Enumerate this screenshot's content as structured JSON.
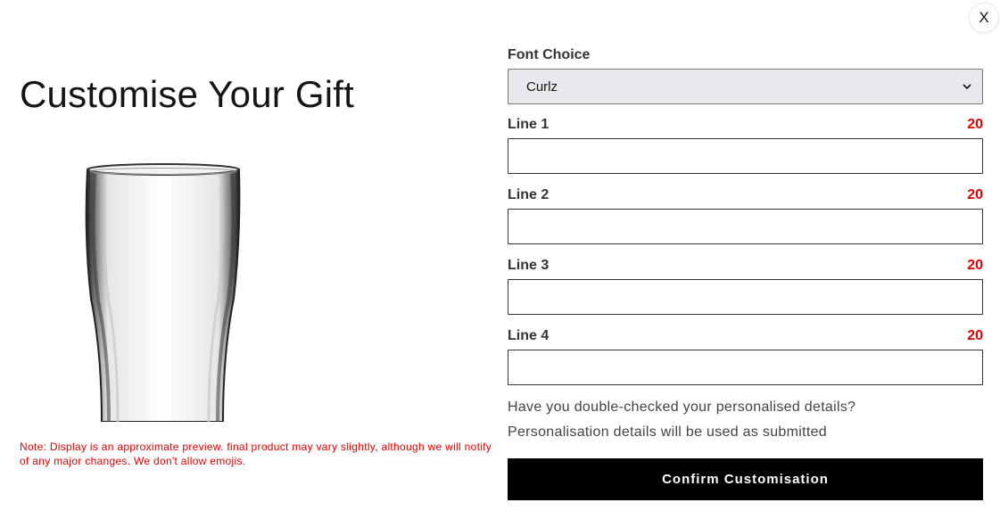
{
  "modal": {
    "close_label": "X",
    "title": "Customise Your Gift",
    "note": "Note: Display is an approximate preview. final product may vary slightly, although we will notify of any major changes. We don't allow emojis."
  },
  "form": {
    "font_choice_label": "Font Choice",
    "font_choice_value": "Curlz",
    "lines": [
      {
        "label": "Line 1",
        "counter": "20",
        "value": ""
      },
      {
        "label": "Line 2",
        "counter": "20",
        "value": ""
      },
      {
        "label": "Line 3",
        "counter": "20",
        "value": ""
      },
      {
        "label": "Line 4",
        "counter": "20",
        "value": ""
      }
    ],
    "check_question": "Have you double-checked your personalised details?",
    "check_notice": "Personalisation details will be used as submitted",
    "confirm_label": "Confirm Customisation"
  },
  "icons": {
    "close": "close-icon",
    "dropdown": "chevron-down-icon",
    "preview": "pint-glass-image"
  },
  "colors": {
    "accent_red": "#e00000",
    "button_bg": "#000000",
    "button_text": "#ffffff",
    "select_bg": "#e9e9ed"
  }
}
